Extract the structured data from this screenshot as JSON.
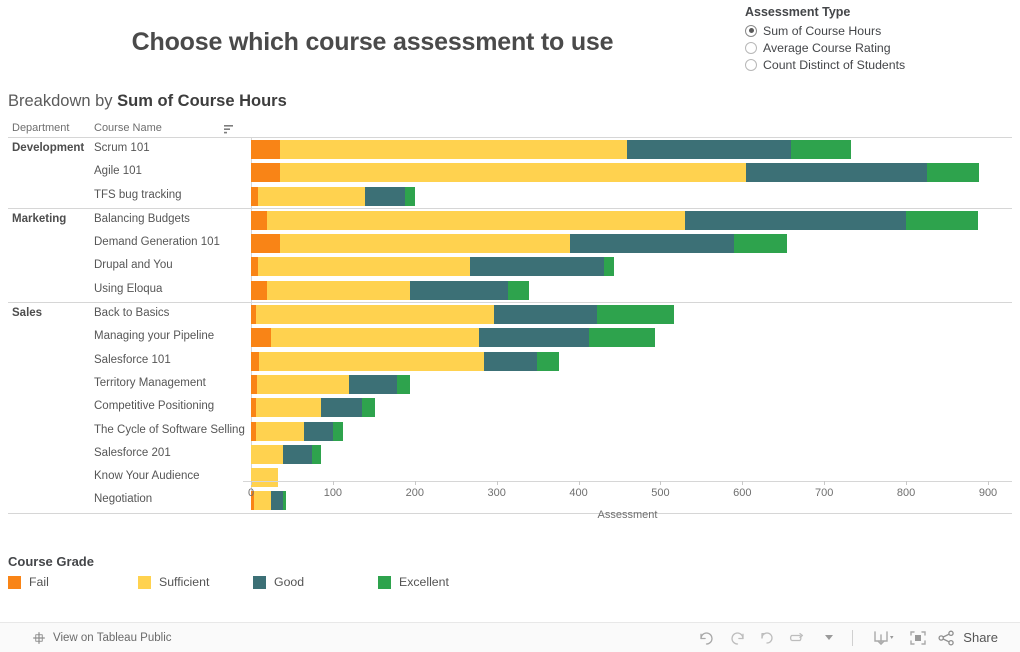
{
  "header": {
    "title": "Choose which course assessment to use"
  },
  "parameter": {
    "title": "Assessment Type",
    "options": [
      {
        "label": "Sum of Course Hours",
        "selected": true
      },
      {
        "label": "Average Course Rating",
        "selected": false
      },
      {
        "label": "Count Distinct of Students",
        "selected": false
      }
    ]
  },
  "breakdown": {
    "prefix": "Breakdown by ",
    "measure": "Sum of Course Hours"
  },
  "table": {
    "col_department": "Department",
    "col_course": "Course Name",
    "sort_icon": "sort-icon"
  },
  "legend": {
    "title": "Course Grade",
    "items": [
      {
        "label": "Fail",
        "color": "#F98416"
      },
      {
        "label": "Sufficient",
        "color": "#FFD24F"
      },
      {
        "label": "Good",
        "color": "#3C7076"
      },
      {
        "label": "Excellent",
        "color": "#2EA34D"
      }
    ]
  },
  "toolbar": {
    "view_label": "View on Tableau Public",
    "share_label": "Share",
    "buttons": [
      {
        "name": "undo-button",
        "icon": "undo-icon"
      },
      {
        "name": "redo-button",
        "icon": "redo-icon"
      },
      {
        "name": "revert-button",
        "icon": "revert-icon"
      },
      {
        "name": "refresh-button",
        "icon": "refresh-icon"
      },
      {
        "name": "refresh-dropdown-button",
        "icon": "chevron-down-icon"
      },
      {
        "name": "download-button",
        "icon": "download-icon"
      },
      {
        "name": "download-dropdown-button",
        "icon": "chevron-down-icon"
      },
      {
        "name": "fullscreen-button",
        "icon": "fullscreen-icon"
      },
      {
        "name": "share-button",
        "icon": "share-icon"
      }
    ]
  },
  "chart_data": {
    "type": "bar",
    "orientation": "horizontal",
    "stacked": true,
    "title": "Breakdown by Sum of Course Hours",
    "xlabel": "Assessment",
    "ylabel": "",
    "xlim": [
      0,
      900
    ],
    "xticks": [
      0,
      100,
      200,
      300,
      400,
      500,
      600,
      700,
      800,
      900
    ],
    "grid": false,
    "legend_position": "bottom",
    "series": [
      {
        "name": "Fail",
        "color": "#F98416"
      },
      {
        "name": "Sufficient",
        "color": "#FFD24F"
      },
      {
        "name": "Good",
        "color": "#3C7076"
      },
      {
        "name": "Excellent",
        "color": "#2EA34D"
      }
    ],
    "groups": [
      {
        "department": "Development",
        "rows": [
          {
            "course": "Scrum 101",
            "values": [
              36,
              423,
              200,
              74
            ],
            "total": 733
          },
          {
            "course": "Agile 101",
            "values": [
              36,
              568,
              222,
              63
            ],
            "total": 889
          },
          {
            "course": "TFS bug tracking",
            "values": [
              8,
              131,
              49,
              12
            ],
            "total": 200
          }
        ]
      },
      {
        "department": "Marketing",
        "rows": [
          {
            "course": "Balancing Budgets",
            "values": [
              19,
              511,
              270,
              88
            ],
            "total": 888
          },
          {
            "course": "Demand Generation 101",
            "values": [
              36,
              354,
              200,
              64
            ],
            "total": 654
          },
          {
            "course": "Drupal and You",
            "values": [
              8,
              259,
              164,
              12
            ],
            "total": 443
          },
          {
            "course": "Using Eloqua",
            "values": [
              19,
              175,
              120,
              25
            ],
            "total": 339
          }
        ]
      },
      {
        "department": "Sales",
        "rows": [
          {
            "course": "Back to Basics",
            "values": [
              6,
              291,
              125,
              94
            ],
            "total": 516
          },
          {
            "course": "Managing your Pipeline",
            "values": [
              25,
              253,
              135,
              80
            ],
            "total": 493
          },
          {
            "course": "Salesforce 101",
            "values": [
              10,
              274,
              65,
              27
            ],
            "total": 376
          },
          {
            "course": "Territory Management",
            "values": [
              7,
              113,
              58,
              16
            ],
            "total": 194
          },
          {
            "course": "Competitive Positioning",
            "values": [
              6,
              80,
              50,
              15
            ],
            "total": 151
          },
          {
            "course": "The Cycle of Software Selling",
            "values": [
              6,
              59,
              35,
              12
            ],
            "total": 112
          },
          {
            "course": "Salesforce 201",
            "values": [
              0,
              39,
              36,
              10
            ],
            "total": 85
          },
          {
            "course": "Know Your Audience",
            "values": [
              0,
              33,
              0,
              0
            ],
            "total": 33
          },
          {
            "course": "Negotiation",
            "values": [
              4,
              20,
              15,
              4
            ],
            "total": 43
          }
        ]
      }
    ]
  }
}
